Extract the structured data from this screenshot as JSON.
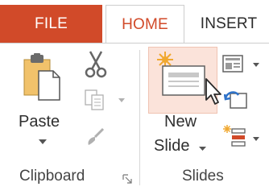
{
  "tabs": {
    "file": "FILE",
    "home": "HOME",
    "insert": "INSERT"
  },
  "clipboard": {
    "paste_label": "Paste",
    "group_label": "Clipboard"
  },
  "slides": {
    "new_slide_line1": "New",
    "new_slide_line2": "Slide",
    "group_label": "Slides"
  },
  "colors": {
    "accent": "#d14a29",
    "highlight": "#fbe3da"
  },
  "icons": {
    "paste": "clipboard-paste-icon",
    "cut": "scissors-icon",
    "copy": "copy-icon",
    "format_painter": "paintbrush-icon",
    "new_slide": "new-slide-icon",
    "layout": "layout-icon",
    "reset": "reset-icon",
    "section": "section-icon",
    "cursor": "mouse-pointer-icon",
    "dialog_launcher": "dialog-launcher-icon"
  }
}
